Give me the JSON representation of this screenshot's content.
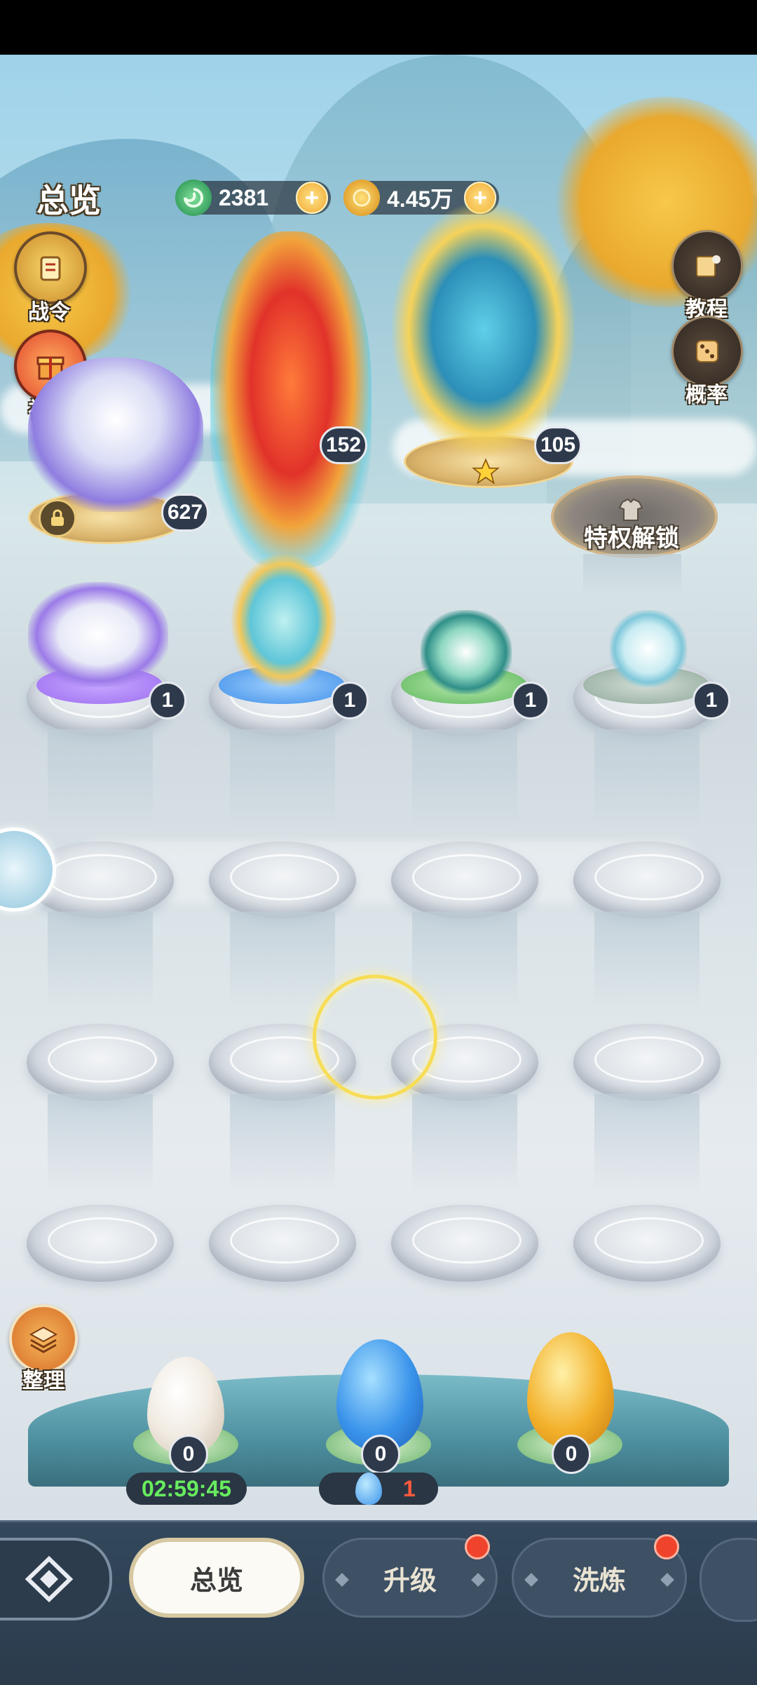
{
  "header": {
    "title": "总览",
    "jade": {
      "value": "2381",
      "icon": "jade-swirl-icon"
    },
    "gold": {
      "value": "4.45万",
      "icon": "gold-coin-icon"
    }
  },
  "side_left": {
    "battle_pass_label": "战令",
    "gift_label": "礼包",
    "organize_label": "整理"
  },
  "side_right": {
    "tutorial_label": "教程",
    "odds_label": "概率"
  },
  "top_pets": [
    {
      "name": "white-tiger",
      "count": "627",
      "locked_icon": true
    },
    {
      "name": "phoenix",
      "count": "152"
    },
    {
      "name": "azure-dragon",
      "count": "105",
      "starred": true
    }
  ],
  "privilege_slot_label": "特权解锁",
  "row_pets": [
    {
      "name": "winged-tiger-cub",
      "count": "1",
      "pad_color": "#9c6cf0"
    },
    {
      "name": "blue-dragon-cub",
      "count": "1",
      "pad_color": "#3f8fe8"
    },
    {
      "name": "turtle-cub",
      "count": "1",
      "pad_color": "#5db55a"
    },
    {
      "name": "little-dragon-cub",
      "count": "1",
      "pad_color": "#8fa89a"
    }
  ],
  "eggs": [
    {
      "name": "white-egg",
      "count": "0",
      "color": "#f1ebe2"
    },
    {
      "name": "blue-egg",
      "count": "0",
      "color": "#3a93ea"
    },
    {
      "name": "gold-egg",
      "count": "0",
      "color": "#f2b02a"
    }
  ],
  "egg_timer": "02:59:45",
  "egg_stock": "1",
  "tabs": [
    {
      "label": "总览",
      "active": true
    },
    {
      "label": "升级",
      "badge": true
    },
    {
      "label": "洗炼",
      "badge": true
    }
  ],
  "colors": {
    "accent_gold": "#f7dd57",
    "nav_bg": "#33485c",
    "badge_red": "#f0432c"
  }
}
